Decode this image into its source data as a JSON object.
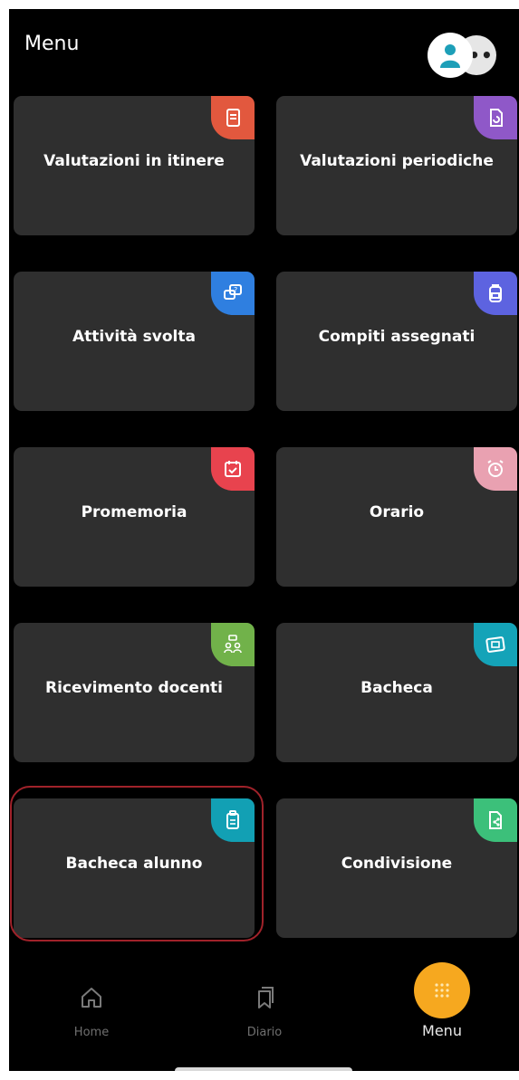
{
  "header": {
    "title": "Menu",
    "more": "••"
  },
  "cards": [
    {
      "label": "Valutazioni in itinere",
      "icon": "clipboard-doc-icon",
      "color": "#e2583e"
    },
    {
      "label": "Valutazioni periodiche",
      "icon": "document-rotate-icon",
      "color": "#8f58c8"
    },
    {
      "label": "Attività svolta",
      "icon": "chat-question-icon",
      "color": "#2f7fe0"
    },
    {
      "label": "Compiti assegnati",
      "icon": "backpack-icon",
      "color": "#5d63e0"
    },
    {
      "label": "Promemoria",
      "icon": "calendar-check-icon",
      "color": "#e8434e"
    },
    {
      "label": "Orario",
      "icon": "alarm-clock-icon",
      "color": "#e9a1b1"
    },
    {
      "label": "Ricevimento docenti",
      "icon": "meeting-icon",
      "color": "#71b24a"
    },
    {
      "label": "Bacheca",
      "icon": "noticeboard-icon",
      "color": "#14a3b8"
    },
    {
      "label": "Bacheca alunno",
      "icon": "clipboard-icon",
      "color": "#12a0b4"
    },
    {
      "label": "Condivisione",
      "icon": "share-document-icon",
      "color": "#3cc07a"
    }
  ],
  "nav": {
    "home_label": "Home",
    "diario_label": "Diario",
    "menu_label": "Menu"
  },
  "colors": {
    "accent": "#f6a81f",
    "card": "#2f2f2f",
    "highlight": "#a0222a"
  }
}
